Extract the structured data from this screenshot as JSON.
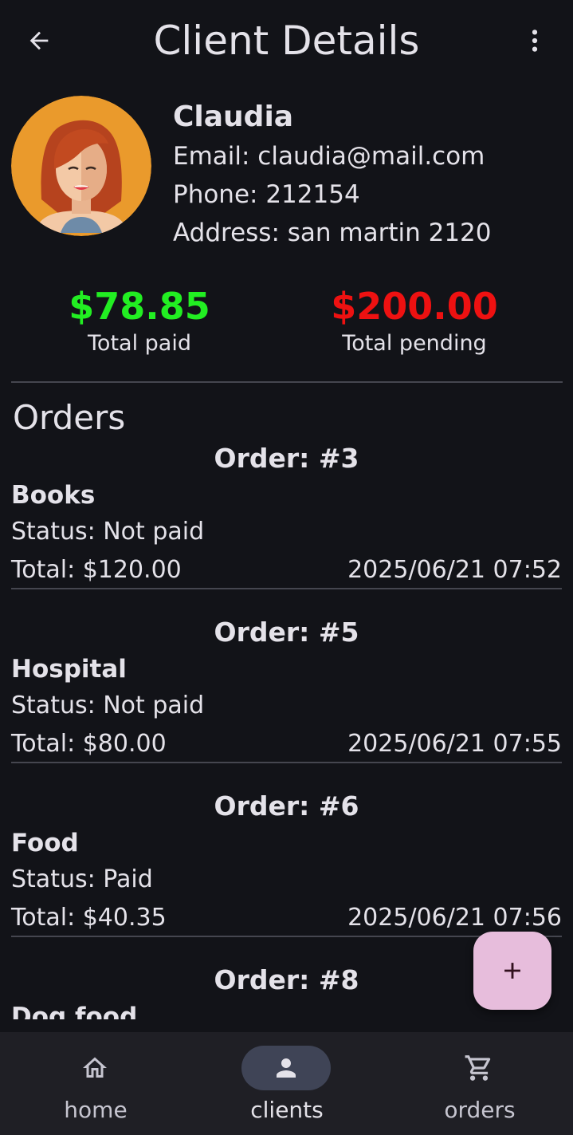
{
  "app_bar": {
    "title": "Client Details",
    "back_icon": "arrow-back-icon",
    "menu_icon": "more-vert-icon"
  },
  "client": {
    "name": "Claudia",
    "email": "Email: claudia@mail.com",
    "phone": "Phone: 212154",
    "address": "Address: san martin 2120",
    "avatar_icon": "female-avatar-icon"
  },
  "totals": {
    "paid": {
      "amount": "$78.85",
      "label": "Total paid",
      "color": "#22EE22"
    },
    "pending": {
      "amount": "$200.00",
      "label": "Total pending",
      "color": "#EE1111"
    }
  },
  "orders": {
    "title": "Orders",
    "items": [
      {
        "number": "Order: #3",
        "name": "Books",
        "status": "Status: Not paid",
        "total": "Total: $120.00",
        "date": "2025/06/21 07:52"
      },
      {
        "number": "Order: #5",
        "name": "Hospital",
        "status": "Status: Not paid",
        "total": "Total: $80.00",
        "date": "2025/06/21 07:55"
      },
      {
        "number": "Order: #6",
        "name": "Food",
        "status": "Status: Paid",
        "total": "Total: $40.35",
        "date": "2025/06/21 07:56"
      },
      {
        "number": "Order: #8",
        "name": "Dog food",
        "status": "",
        "total": "",
        "date": ""
      }
    ]
  },
  "fab": {
    "icon": "add-icon",
    "color": "#E7BDDC"
  },
  "bottom_nav": {
    "items": [
      {
        "label": "home",
        "icon": "home-icon",
        "active": false
      },
      {
        "label": "clients",
        "icon": "person-icon",
        "active": true
      },
      {
        "label": "orders",
        "icon": "shopping-cart-icon",
        "active": false
      }
    ]
  },
  "theme": {
    "background": "#121318",
    "nav_background": "#1F1F25",
    "active_indicator": "#3F4456",
    "text": "#E4E2E9"
  }
}
